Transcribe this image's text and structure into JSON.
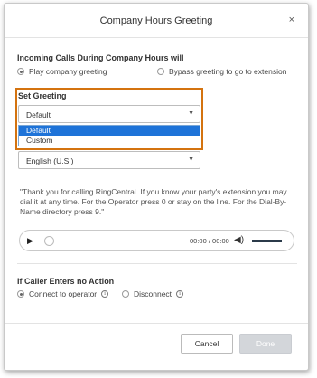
{
  "dialog": {
    "title": "Company Hours Greeting",
    "close_label": "×"
  },
  "incoming": {
    "heading": "Incoming Calls During Company Hours will",
    "options": [
      {
        "label": "Play company greeting",
        "checked": true
      },
      {
        "label": "Bypass greeting to go to extension",
        "checked": false
      }
    ]
  },
  "set_greeting": {
    "heading": "Set Greeting",
    "selected": "Default",
    "arrow": "▼",
    "options": [
      "Default",
      "Custom"
    ]
  },
  "language": {
    "selected": "English (U.S.)",
    "arrow": "▼"
  },
  "message": "\"Thank you for calling RingCentral. If you know your party's extension you may dial it at any time. For the Operator press 0 or stay on the line. For the Dial-By-Name directory press 9.\"",
  "player": {
    "play_symbol": "▶",
    "time": "00:00 / 00:00",
    "volume_symbol": "◀)",
    "progress": 0,
    "volume": 1
  },
  "no_action": {
    "heading": "If Caller Enters no Action",
    "options": [
      {
        "label": "Connect to operator",
        "checked": true
      },
      {
        "label": "Disconnect",
        "checked": false
      }
    ],
    "info_symbol": "i"
  },
  "footer": {
    "cancel_label": "Cancel",
    "done_label": "Done"
  },
  "colors": {
    "highlight": "#d4730f",
    "selected_option": "#1e73d8"
  }
}
